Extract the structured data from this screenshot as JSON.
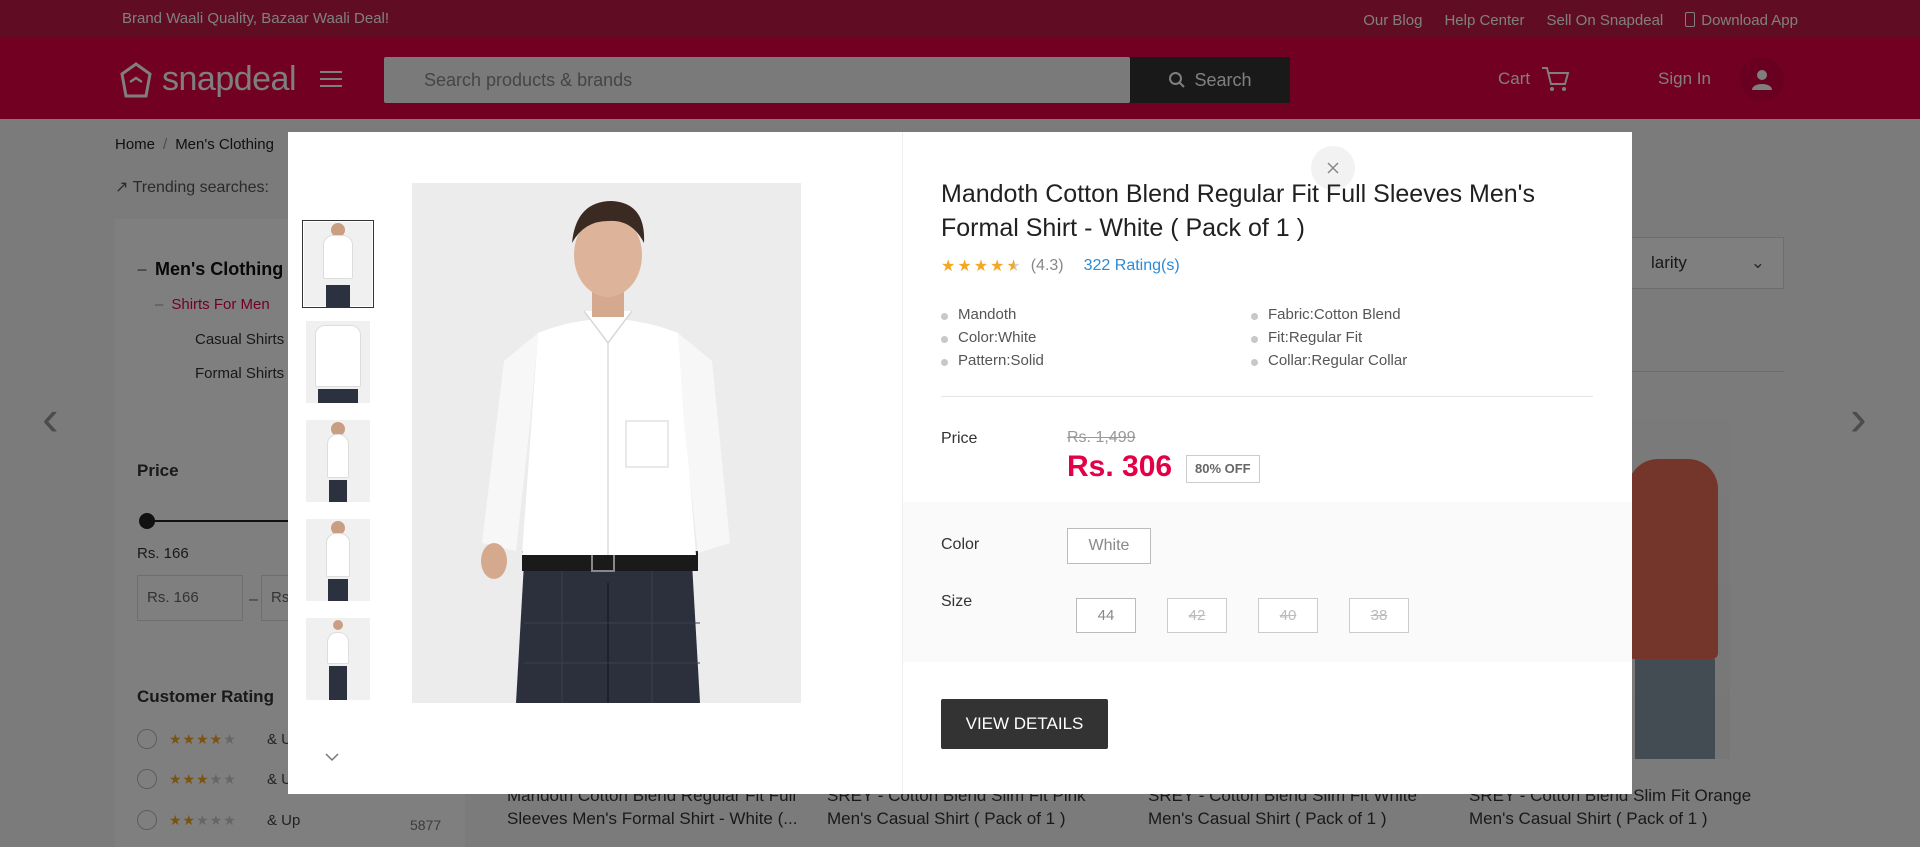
{
  "topbar": {
    "tagline": "Brand Waali Quality, Bazaar Waali Deal!",
    "links": [
      "Our Blog",
      "Help Center",
      "Sell On Snapdeal",
      "Download App"
    ]
  },
  "header": {
    "logo_text": "snapdeal",
    "search_placeholder": "Search products & brands",
    "search_button": "Search",
    "cart_label": "Cart",
    "signin_label": "Sign In",
    "brand_color": "#e40046"
  },
  "background": {
    "breadcrumb": [
      "Home",
      "Men's Clothing"
    ],
    "trending_label": "Trending searches:",
    "categories": {
      "root": "Men's Clothing",
      "sub": "Shirts For Men",
      "children": [
        "Casual Shirts",
        "Formal Shirts"
      ]
    },
    "price_filter": {
      "heading": "Price",
      "min_label": "Rs. 166",
      "min_input": "Rs. 166",
      "max_input": "Rs"
    },
    "rating_filter": {
      "heading": "Customer Rating",
      "options": [
        {
          "label": "& Up",
          "stars": 4
        },
        {
          "label": "& Up",
          "stars": 3
        },
        {
          "label": "& Up",
          "stars": 2
        }
      ],
      "count": "5877"
    },
    "sort_label": "larity",
    "product_titles": [
      "Mandoth Cotton Blend Regular Fit Full Sleeves Men's Formal Shirt - White (...",
      "SREY - Cotton Blend Slim Fit Pink Men's Casual Shirt ( Pack of 1 )",
      "SREY - Cotton Blend Slim Fit White Men's Casual Shirt ( Pack of 1 )",
      "SREY - Cotton Blend Slim Fit Orange Men's Casual Shirt ( Pack of 1 )"
    ]
  },
  "modal": {
    "title": "Mandoth Cotton Blend Regular Fit Full Sleeves Men's Formal Shirt - White ( Pack of 1 )",
    "rating_value": "(4.3)",
    "rating_stars": 4.3,
    "rating_count": "322 Rating(s)",
    "highlights": [
      "Mandoth",
      "Fabric:Cotton Blend",
      "Color:White",
      "Fit:Regular Fit",
      "Pattern:Solid",
      "Collar:Regular Collar"
    ],
    "price_label": "Price",
    "mrp": "Rs. 1,499",
    "price": "Rs. 306",
    "discount": "80% OFF",
    "color_label": "Color",
    "color_value": "White",
    "size_label": "Size",
    "sizes": [
      {
        "label": "44",
        "available": true
      },
      {
        "label": "42",
        "available": false
      },
      {
        "label": "40",
        "available": false
      },
      {
        "label": "38",
        "available": false
      }
    ],
    "view_details": "VIEW DETAILS",
    "thumbnail_count": 5
  }
}
